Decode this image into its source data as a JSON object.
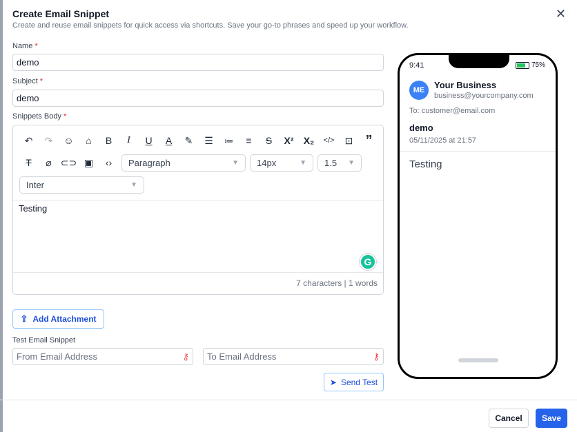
{
  "dialog": {
    "title": "Create Email Snippet",
    "subtitle": "Create and reuse email snippets for quick access via shortcuts. Save your go-to phrases and speed up your workflow.",
    "close_icon": "close-icon"
  },
  "form": {
    "name_label": "Name",
    "name_value": "demo",
    "subject_label": "Subject",
    "subject_value": "demo",
    "body_label": "Snippets Body",
    "required_mark": "*"
  },
  "editor": {
    "toolbar_row1": [
      "undo-icon",
      "redo-icon",
      "emoji-icon",
      "tag-icon",
      "bold-icon",
      "italic-icon",
      "underline-icon",
      "font-color-icon",
      "highlight-icon",
      "bullet-list-icon",
      "numbered-list-icon",
      "align-icon",
      "strikethrough-icon",
      "superscript-icon",
      "subscript-icon",
      "code-icon",
      "embed-icon",
      "quote-icon"
    ],
    "toolbar_row2": [
      "clear-format-icon",
      "clear-highlight-icon",
      "link-icon",
      "image-icon",
      "source-code-icon"
    ],
    "block_format": "Paragraph",
    "font_size": "14px",
    "line_height": "1.5",
    "font_family": "Inter",
    "content": "Testing",
    "grammarly_letter": "G",
    "counter": "7 characters | 1 words"
  },
  "attachment": {
    "button_label": "Add Attachment"
  },
  "test": {
    "label": "Test Email Snippet",
    "from_placeholder": "From Email Address",
    "to_placeholder": "To Email Address",
    "send_label": "Send Test"
  },
  "footer": {
    "cancel_label": "Cancel",
    "save_label": "Save"
  },
  "preview": {
    "time": "9:41",
    "battery": "75%",
    "battery_level": 0.75,
    "avatar_initials": "ME",
    "business_name": "Your Business",
    "business_email": "business@yourcompany.com",
    "to_line": "To: customer@email.com",
    "subject": "demo",
    "date": "05/11/2025 at 21:57",
    "body": "Testing"
  },
  "colors": {
    "primary": "#2563eb",
    "required": "#dc2626",
    "battery": "#22c55e",
    "avatar": "#3b82f6"
  }
}
